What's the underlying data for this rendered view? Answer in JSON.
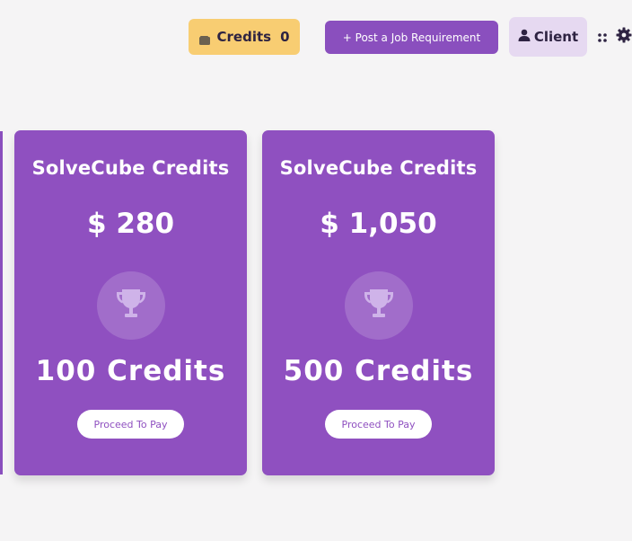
{
  "header": {
    "credits_label": "Credits",
    "credits_count": "0",
    "post_job_label": "+ Post a Job Requirement",
    "client_label": "Client"
  },
  "cards": [
    {
      "title": "SolveCube Credits",
      "price": "$ 280",
      "credits": "100 Credits",
      "button": "Proceed To Pay"
    },
    {
      "title": "SolveCube Credits",
      "price": "$ 1,050",
      "credits": "500 Credits",
      "button": "Proceed To Pay"
    }
  ],
  "icons": {
    "wallet": "wallet-icon",
    "user": "user-icon",
    "grid": "grid-icon",
    "settings": "gear-icon",
    "trophy": "trophy-icon"
  },
  "colors": {
    "accent": "#8f50c0",
    "credits_pill": "#f8cd72",
    "client_pill": "#e6d9f1",
    "background": "#f5f4f5"
  }
}
